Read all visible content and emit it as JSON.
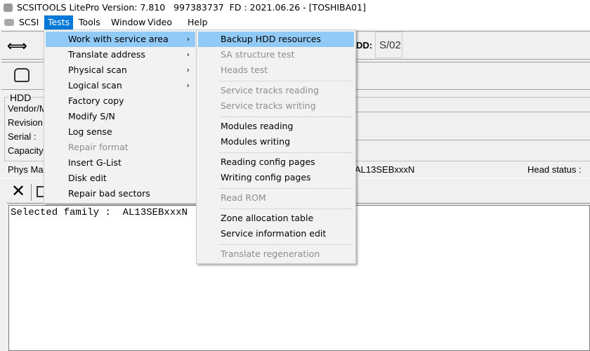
{
  "window": {
    "title": "SCSITOOLS LitePro Version: 7.810   997383737  FD : 2021.06.26 - [TOSHIBA01]"
  },
  "menubar": [
    "SCSI",
    "Tests",
    "Tools",
    "Window",
    "Video",
    "Help"
  ],
  "toolbar": {
    "hdd_label": "DD:",
    "hdd_value": "S/02"
  },
  "hdd_group": {
    "title": "HDD",
    "fields": [
      "Vendor/M",
      "Revision",
      "Serial :",
      "Capacity"
    ]
  },
  "status": {
    "phys_label": "Phys Ma",
    "family": "AL13SEBxxxN",
    "head_status": "Head status :"
  },
  "log": {
    "text": "Selected family :  AL13SEBxxxN"
  },
  "tests_menu": [
    {
      "label": "Work with service area",
      "submenu": true,
      "highlighted": true
    },
    {
      "label": "Translate address",
      "submenu": true
    },
    {
      "label": "Physical scan",
      "submenu": true
    },
    {
      "label": "Logical scan",
      "submenu": true
    },
    {
      "label": "Factory copy"
    },
    {
      "label": "Modify S/N"
    },
    {
      "label": "Log sense"
    },
    {
      "label": "Repair format",
      "disabled": true
    },
    {
      "label": "Insert G-List"
    },
    {
      "label": "Disk edit"
    },
    {
      "label": "Repair bad sectors"
    }
  ],
  "service_menu": [
    {
      "label": "Backup HDD resources",
      "highlighted": true
    },
    {
      "label": "SA structure test",
      "disabled": true
    },
    {
      "label": "Heads test",
      "disabled": true
    },
    {
      "label": "Service tracks reading",
      "disabled": true
    },
    {
      "label": "Service tracks writing",
      "disabled": true
    },
    {
      "label": "Modules reading"
    },
    {
      "label": "Modules writing"
    },
    {
      "label": "Reading config pages"
    },
    {
      "label": "Writing config pages"
    },
    {
      "label": "Read ROM",
      "disabled": true
    },
    {
      "label": "Zone allocation table"
    },
    {
      "label": "Service information edit"
    },
    {
      "label": "Translate regeneration",
      "disabled": true
    }
  ],
  "colors": {
    "highlight": "#91c9f7",
    "menubar_active": "#0078d7"
  }
}
